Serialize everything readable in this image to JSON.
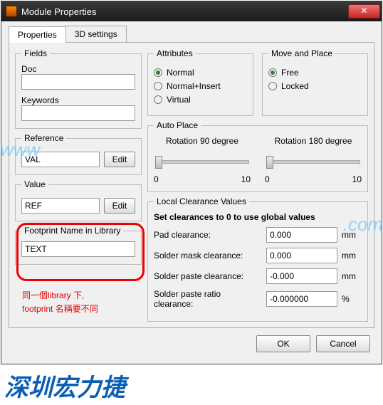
{
  "title": "Module Properties",
  "tabs": {
    "properties": "Properties",
    "threeD": "3D settings"
  },
  "fields": {
    "legend": "Fields",
    "doc_label": "Doc",
    "doc_value": "",
    "kw_label": "Keywords",
    "kw_value": "",
    "ref_label": "Reference",
    "ref_value": "VAL",
    "ref_edit": "Edit",
    "val_label": "Value",
    "val_value": "REF",
    "val_edit": "Edit",
    "fp_label": "Footprint Name in Library",
    "fp_value": "TEXT"
  },
  "attributes": {
    "legend": "Attributes",
    "normal": "Normal",
    "normal_insert": "Normal+Insert",
    "virtual": "Virtual"
  },
  "moveplace": {
    "legend": "Move and Place",
    "free": "Free",
    "locked": "Locked"
  },
  "autoplace": {
    "legend": "Auto Place",
    "rot90": "Rotation 90 degree",
    "rot180": "Rotation 180 degree",
    "min": "0",
    "max": "10"
  },
  "clearance": {
    "legend": "Local Clearance Values",
    "hint": "Set clearances to 0 to use global values",
    "pad_lbl": "Pad clearance:",
    "pad_val": "0.000",
    "pad_unit": "mm",
    "mask_lbl": "Solder mask clearance:",
    "mask_val": "0.000",
    "mask_unit": "mm",
    "paste_lbl": "Solder paste clearance:",
    "paste_val": "-0.000",
    "paste_unit": "mm",
    "ratio_lbl": "Solder paste ratio clearance:",
    "ratio_val": "-0.000000",
    "ratio_unit": "%"
  },
  "buttons": {
    "ok": "OK",
    "cancel": "Cancel"
  },
  "annot": {
    "l1": "同一個library 下,",
    "l2": "footprint 名稱要不同"
  },
  "brand": "深圳宏力捷",
  "wm_left": "www",
  "wm_right": ".com"
}
